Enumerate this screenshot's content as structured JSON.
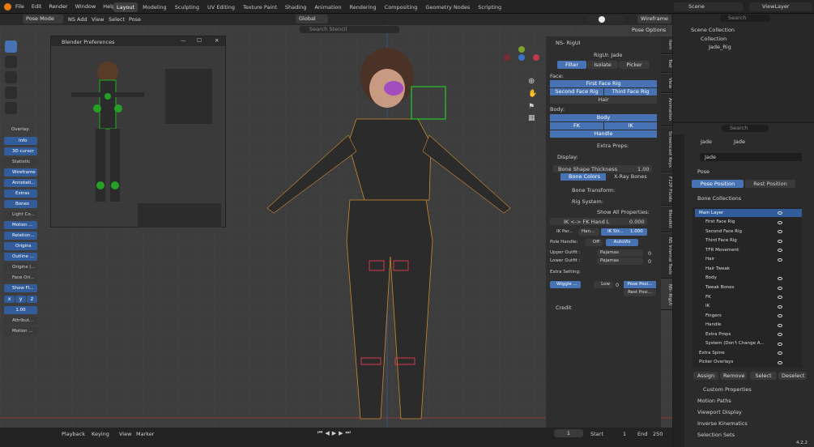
{
  "menu": [
    "File",
    "Edit",
    "Render",
    "Window",
    "Help"
  ],
  "workspace_tabs": [
    "Layout",
    "Modeling",
    "Sculpting",
    "UV Editing",
    "Texture Paint",
    "Shading",
    "Animation",
    "Rendering",
    "Compositing",
    "Geometry Nodes",
    "Scripting"
  ],
  "active_tab": "Layout",
  "scene": "Scene",
  "view_layer": "ViewLayer",
  "viewport_header": {
    "mode": "Pose Mode",
    "ns_add": "NS Add",
    "view": "View",
    "select": "Select",
    "pose": "Pose",
    "transform": "Global",
    "search": "Search Stencil",
    "pose_options": "Pose Options",
    "shading": "Wireframe"
  },
  "prefs_window": {
    "title": "Blender Preferences"
  },
  "overlay": {
    "label": "Overlay:",
    "items": [
      "Info",
      "3D cursor",
      "Statistic",
      "Wireframe",
      "Annotati...",
      "Extras",
      "Bones",
      "Light Co...",
      "Motion ...",
      "Relation...",
      "Origins",
      "Outline ...",
      "Origins (...",
      "Face Ori...",
      "Show Fl..."
    ],
    "xyz": [
      "x",
      "y",
      "z"
    ],
    "value": "1.00",
    "more": [
      "Attribut...",
      "Motion ..."
    ]
  },
  "n_panel": {
    "title": "NS- RigUI",
    "rig_label": "RigUI: Jade",
    "filter": "Filter",
    "isolate": "Isolate",
    "picker": "Picker",
    "face": "Face:",
    "first_face_rig": "First Face Rig",
    "second_face_rig": "Second Face Rig",
    "third_face_rig": "Third Face Rig",
    "hair": "Hair",
    "body_label": "Body:",
    "body": "Body",
    "fk": "FK",
    "ik": "IK",
    "handle": "Handle",
    "extra_props": "Extra Props:",
    "display": "Display:",
    "bone_shape": "Bone Shape Thickness",
    "bone_shape_val": "1.00",
    "bone_colors": "Bone Colors",
    "xray": "X-Ray Bones",
    "bone_transform": "Bone Transform:",
    "rig_system": "Rig System:",
    "show_all": "Show All Properties:",
    "ik_fk": "IK <-> FK Hand L",
    "ik_fk_val": "0.000",
    "ik_par": "IK Par...",
    "han": "Han...",
    "ik_str": "IK Str...",
    "ik_str_val": "1.000",
    "pole_handle": "Pole Handle:",
    "off": "Off",
    "autovis": "AutoVis",
    "upper_outfit": "Upper Outfit :",
    "lower_outfit": "Lower Outfit :",
    "pajamas": "Pajamas",
    "zero": "0",
    "extra_setting": "Extra Setting:",
    "wiggle": "Wiggle ...",
    "low": "Low",
    "pose_posi": "Pose Posi...",
    "rest_posi": "Rest Posi...",
    "credit": "Credit"
  },
  "vtabs": [
    "Item",
    "Tool",
    "View",
    "Animation",
    "Screencast Keys",
    "F12P Fluids",
    "Blendkit",
    "NS Internal Tools",
    "NS- RigUI"
  ],
  "outliner": {
    "scene_collection": "Scene Collection",
    "collection": "Collection",
    "jade_rig": "Jade_Rig",
    "search": "Search"
  },
  "properties": {
    "object": "Jade",
    "data": "Jade",
    "name": "Jade",
    "search": "Search",
    "pose": "Pose",
    "pose_position": "Pose Position",
    "rest_position": "Rest Position",
    "bone_collections": "Bone Collections",
    "collections": [
      "Main Layer",
      "First Face Rig",
      "Second Face Rig",
      "Third Face Rig",
      "TFR Movement",
      "Hair",
      "Hair Tweak",
      "Body",
      "Tweak Bones",
      "FK",
      "IK",
      "Fingers",
      "Handle",
      "Extra Props",
      "System (Don't Change A...",
      "Extra Spine",
      "Picker Overlays"
    ],
    "assign": "Assign",
    "remove": "Remove",
    "select": "Select",
    "deselect": "Deselect",
    "sections": [
      "Custom Properties",
      "Motion Paths",
      "Viewport Display",
      "Inverse Kinematics",
      "Selection Sets"
    ]
  },
  "timeline": {
    "playback": "Playback",
    "keying": "Keying",
    "view": "View",
    "marker": "Marker",
    "frame": "1",
    "start_label": "Start",
    "start": "1",
    "end_label": "End",
    "end": "250"
  },
  "version": "4.2.2"
}
